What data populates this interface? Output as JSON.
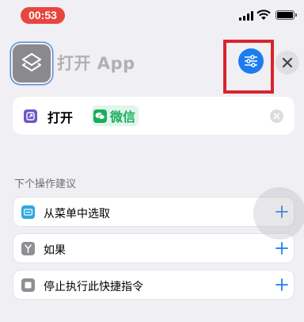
{
  "status_bar": {
    "time": "00:53",
    "battery_level": 0.9
  },
  "header": {
    "action_title": "打开 App",
    "app_icon": "shortcuts-layers-icon",
    "settings_icon": "sliders-icon",
    "close_icon": "close-icon"
  },
  "action_card": {
    "verb": "打开",
    "app_name": "微信",
    "app_icon": "wechat-icon",
    "clear_icon": "clear-icon"
  },
  "suggestions": {
    "header": "下个操作建议",
    "items": [
      {
        "label": "从菜单中选取",
        "icon": "menu-icon",
        "color": "#2ea8e0"
      },
      {
        "label": "如果",
        "icon": "branch-icon",
        "color": "#8e8e93"
      },
      {
        "label": "停止执行此快捷指令",
        "icon": "stop-icon",
        "color": "#8e8e93"
      }
    ]
  },
  "colors": {
    "accent": "#1c7cf0",
    "highlight": "#d9232e",
    "wechat": "#1aad5b",
    "open_app_icon": "#6f56c8"
  }
}
